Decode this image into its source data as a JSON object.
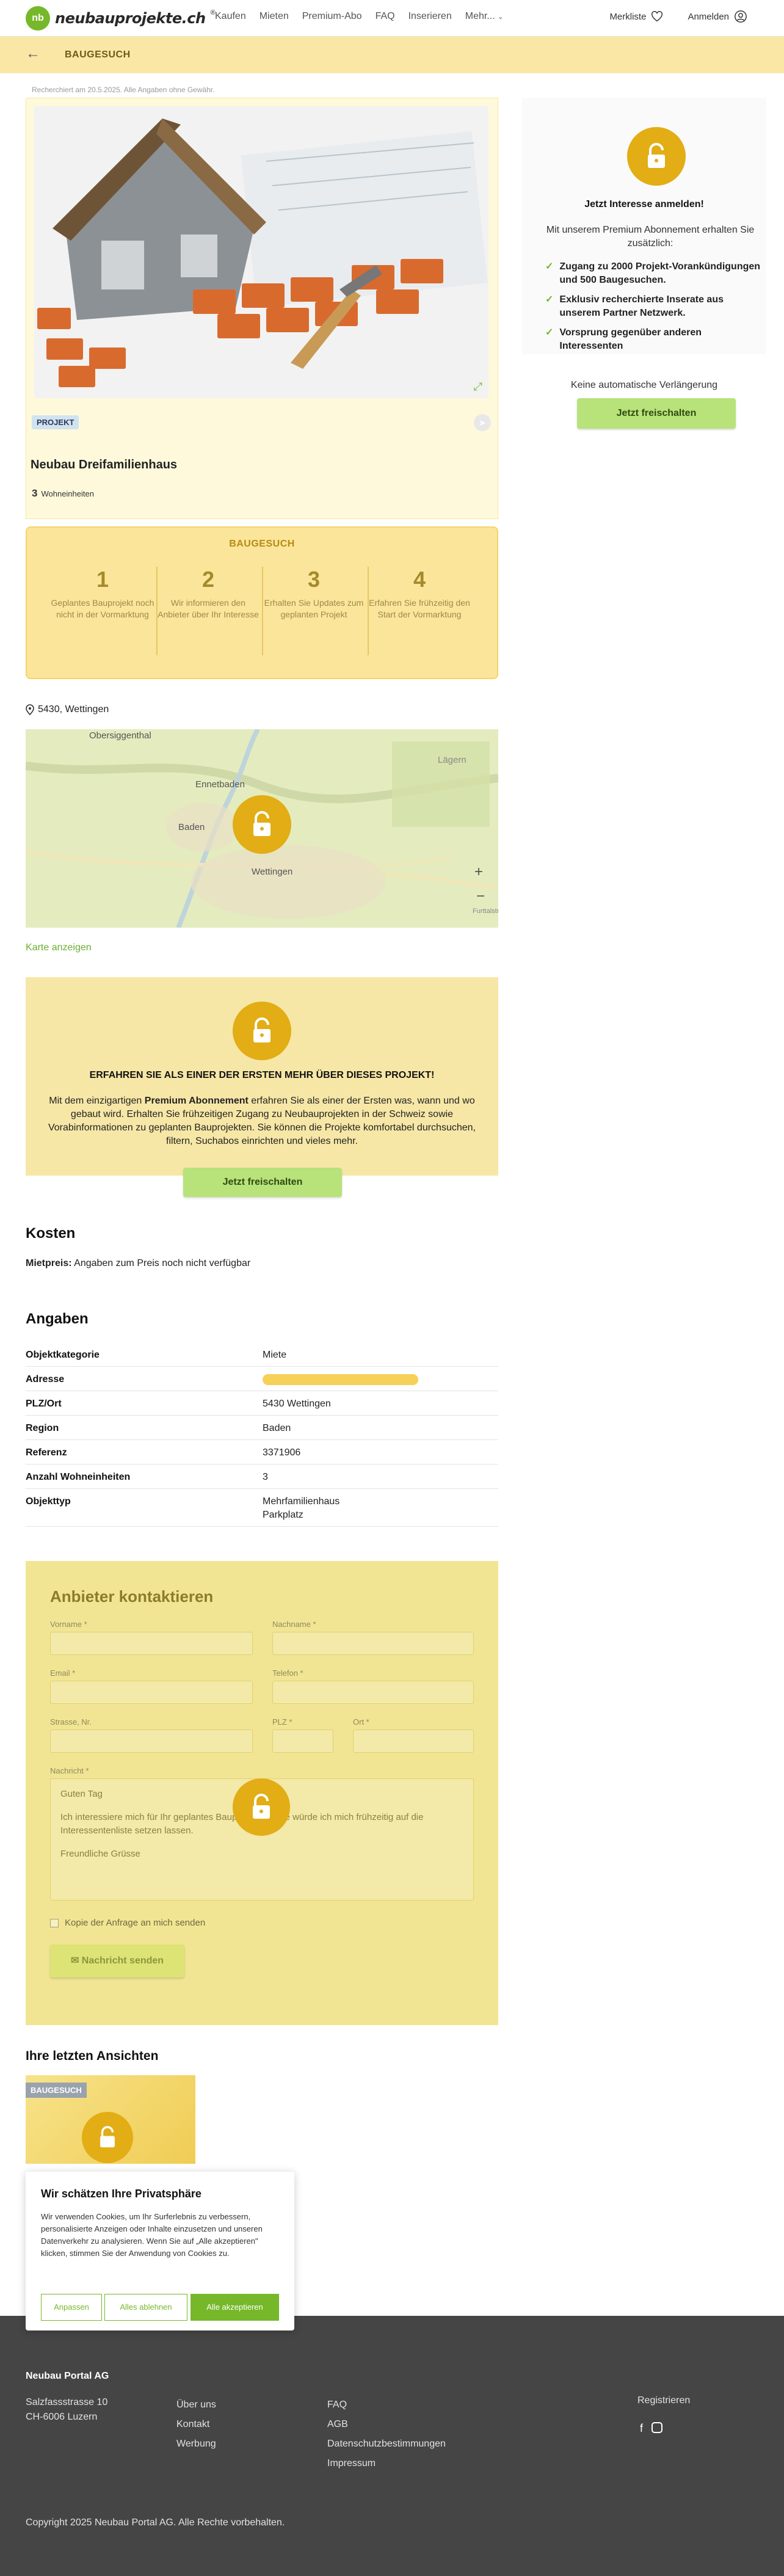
{
  "header": {
    "logo_text": "neubauprojekte.ch",
    "logo_mark": "®",
    "nav": [
      "Kaufen",
      "Mieten",
      "Premium-Abo",
      "FAQ",
      "Inserieren",
      "Mehr..."
    ],
    "merkliste": "Merkliste",
    "anmelden": "Anmelden"
  },
  "band": {
    "label": "BAUGESUCH"
  },
  "research_note": "Recherchiert am 20.5.2025. Alle Angaben ohne Gewähr.",
  "listing": {
    "badge": "PROJEKT",
    "title": "Neubau Dreifamilienhaus",
    "units_number": "3",
    "units_label": "Wohneinheiten"
  },
  "steps": {
    "title": "BAUGESUCH",
    "items": [
      {
        "n": "1",
        "t": "Geplantes Bauprojekt noch nicht in der Vormarktung"
      },
      {
        "n": "2",
        "t": "Wir informieren den Anbieter über Ihr Interesse"
      },
      {
        "n": "3",
        "t": "Erhalten Sie Updates zum geplanten Projekt"
      },
      {
        "n": "4",
        "t": "Erfahren Sie frühzeitig den Start der Vormarktung"
      }
    ]
  },
  "location": "5430, Wettingen",
  "map": {
    "labels": [
      "Obersiggenthal",
      "Ennetbaden",
      "Baden",
      "Wettingen",
      "Lägern",
      "Furttalstr."
    ]
  },
  "karte_link": "Karte anzeigen",
  "premium": {
    "heading": "ERFAHREN SIE ALS EINER DER ERSTEN MEHR ÜBER DIESES PROJEKT!",
    "body_pre": "Mit dem einzigartigen ",
    "body_bold": "Premium Abonnement",
    "body_post": " erfahren Sie als einer der Ersten was, wann und wo gebaut wird. Erhalten Sie frühzeitigen Zugang zu Neubauprojekten in der Schweiz sowie Vorabinformationen zu geplanten Bauprojekten. Sie können die Projekte komfortabel durchsuchen, filtern, Suchabos einrichten und vieles mehr.",
    "button": "Jetzt freischalten"
  },
  "kosten": {
    "title": "Kosten",
    "label": "Mietpreis:",
    "value": "Angaben zum Preis noch nicht verfügbar"
  },
  "angaben": {
    "title": "Angaben",
    "rows": [
      {
        "k": "Objektkategorie",
        "v": "Miete"
      },
      {
        "k": "Adresse",
        "v": ""
      },
      {
        "k": "PLZ/Ort",
        "v": "5430 Wettingen"
      },
      {
        "k": "Region",
        "v": "Baden"
      },
      {
        "k": "Referenz",
        "v": "3371906"
      },
      {
        "k": "Anzahl Wohneinheiten",
        "v": "3"
      },
      {
        "k": "Objekttyp",
        "v": "Mehrfamilienhaus",
        "v2": "Parkplatz"
      }
    ]
  },
  "contact": {
    "title": "Anbieter kontaktieren",
    "vorname": "Vorname *",
    "nachname": "Nachname *",
    "email": "Email *",
    "telefon": "Telefon *",
    "strasse": "Strasse, Nr.",
    "plz": "PLZ *",
    "ort": "Ort *",
    "nachricht": "Nachricht *",
    "msg1": "Guten Tag",
    "msg2": "Ich interessiere mich für Ihr geplantes Bauprojekt. Gerne würde ich mich frühzeitig auf die Interessentenliste setzen lassen.",
    "msg3": "Freundliche Grüsse",
    "kopie": "Kopie der Anfrage an mich senden",
    "send": "Nachricht senden"
  },
  "recent": {
    "title": "Ihre letzten Ansichten",
    "badge": "BAUGESUCH"
  },
  "sidebar": {
    "title": "Jetzt Interesse anmelden!",
    "intro": "Mit unserem Premium Abonnement erhalten Sie zusätzlich:",
    "benefits": [
      "Zugang zu 2000 Projekt-Vorankündigungen und 500 Baugesuchen.",
      "Exklusiv recherchierte Inserate aus unserem Partner Netzwerk.",
      "Vorsprung gegenüber anderen Interessenten"
    ],
    "note": "Keine automatische Verlängerung",
    "button": "Jetzt freischalten"
  },
  "cookie": {
    "title": "Wir schätzen Ihre Privatsphäre",
    "text": "Wir verwenden Cookies, um Ihr Surferlebnis zu verbessern, personalisierte Anzeigen oder Inhalte einzusetzen und unseren Datenverkehr zu analysieren. Wenn Sie auf „Alle akzeptieren\" klicken, stimmen Sie der Anwendung von Cookies zu.",
    "anpassen": "Anpassen",
    "ablehnen": "Alles ablehnen",
    "akzeptieren": "Alle akzeptieren"
  },
  "footer": {
    "company": "Neubau Portal AG",
    "street": "Salzfassstrasse 10",
    "city": "CH-6006 Luzern",
    "col2": [
      "Über uns",
      "Kontakt",
      "Werbung"
    ],
    "col3": [
      "FAQ",
      "AGB",
      "Datenschutzbestimmungen",
      "Impressum"
    ],
    "register": "Registrieren",
    "copyright": "Copyright 2025 Neubau Portal AG. Alle Rechte vorbehalten."
  },
  "colors": {
    "accent": "#76b82a",
    "yellow": "#fbe7a5",
    "lock": "#e2ad15"
  }
}
